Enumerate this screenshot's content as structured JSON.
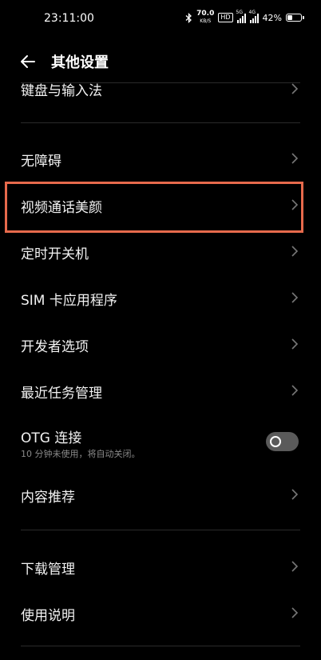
{
  "status_bar": {
    "time": "23:11:00",
    "net_speed_value": "70.0",
    "net_speed_unit": "KB/S",
    "hd_badge": "HD",
    "sim1_label": "5G",
    "sim2_label": "4G",
    "battery_percent": "42%",
    "battery_level": 0.42
  },
  "header": {
    "title": "其他设置"
  },
  "items": [
    {
      "label": "键盘与输入法"
    },
    {
      "label": "无障碍"
    },
    {
      "label": "视频通话美颜"
    },
    {
      "label": "定时开关机"
    },
    {
      "label": "SIM 卡应用程序"
    },
    {
      "label": "开发者选项"
    },
    {
      "label": "最近任务管理"
    },
    {
      "label": "OTG 连接",
      "subtitle": "10 分钟未使用，将自动关闭。",
      "toggle_on": false
    },
    {
      "label": "内容推荐"
    },
    {
      "label": "下载管理"
    },
    {
      "label": "使用说明"
    }
  ],
  "colors": {
    "background": "#000000",
    "highlight_border": "#e76a4c",
    "toggle_off": "#5a5a5a"
  }
}
